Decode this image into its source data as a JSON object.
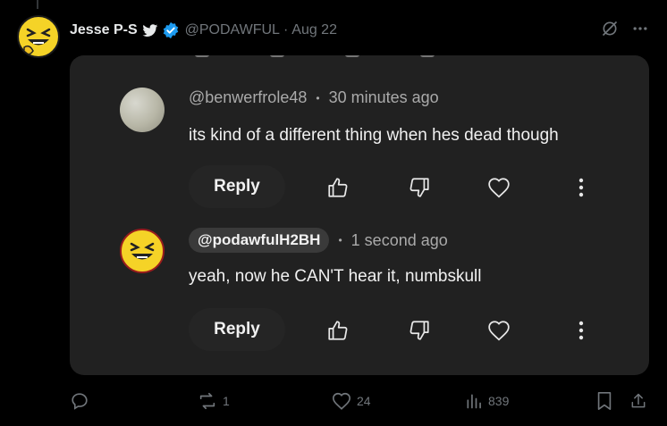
{
  "tweet": {
    "author_name": "Jesse P-S",
    "handle": "@PODAWFUL",
    "separator": "·",
    "date": "Aug 22"
  },
  "comments": [
    {
      "username": "@benwerfrole48",
      "separator": "•",
      "time": "30 minutes ago",
      "text": "its kind of a different thing when hes dead though",
      "reply_label": "Reply"
    },
    {
      "username": "@podawfulH2BH",
      "separator": "•",
      "time": "1 second ago",
      "text": "yeah, now he CAN'T hear it, numbskull",
      "reply_label": "Reply"
    }
  ],
  "footer": {
    "reposts": "1",
    "likes": "24",
    "views": "839"
  },
  "colors": {
    "background": "#000000",
    "card": "#212121",
    "muted": "#71767b",
    "verified": "#1d9bf0",
    "avatar_yellow": "#f5d327"
  }
}
